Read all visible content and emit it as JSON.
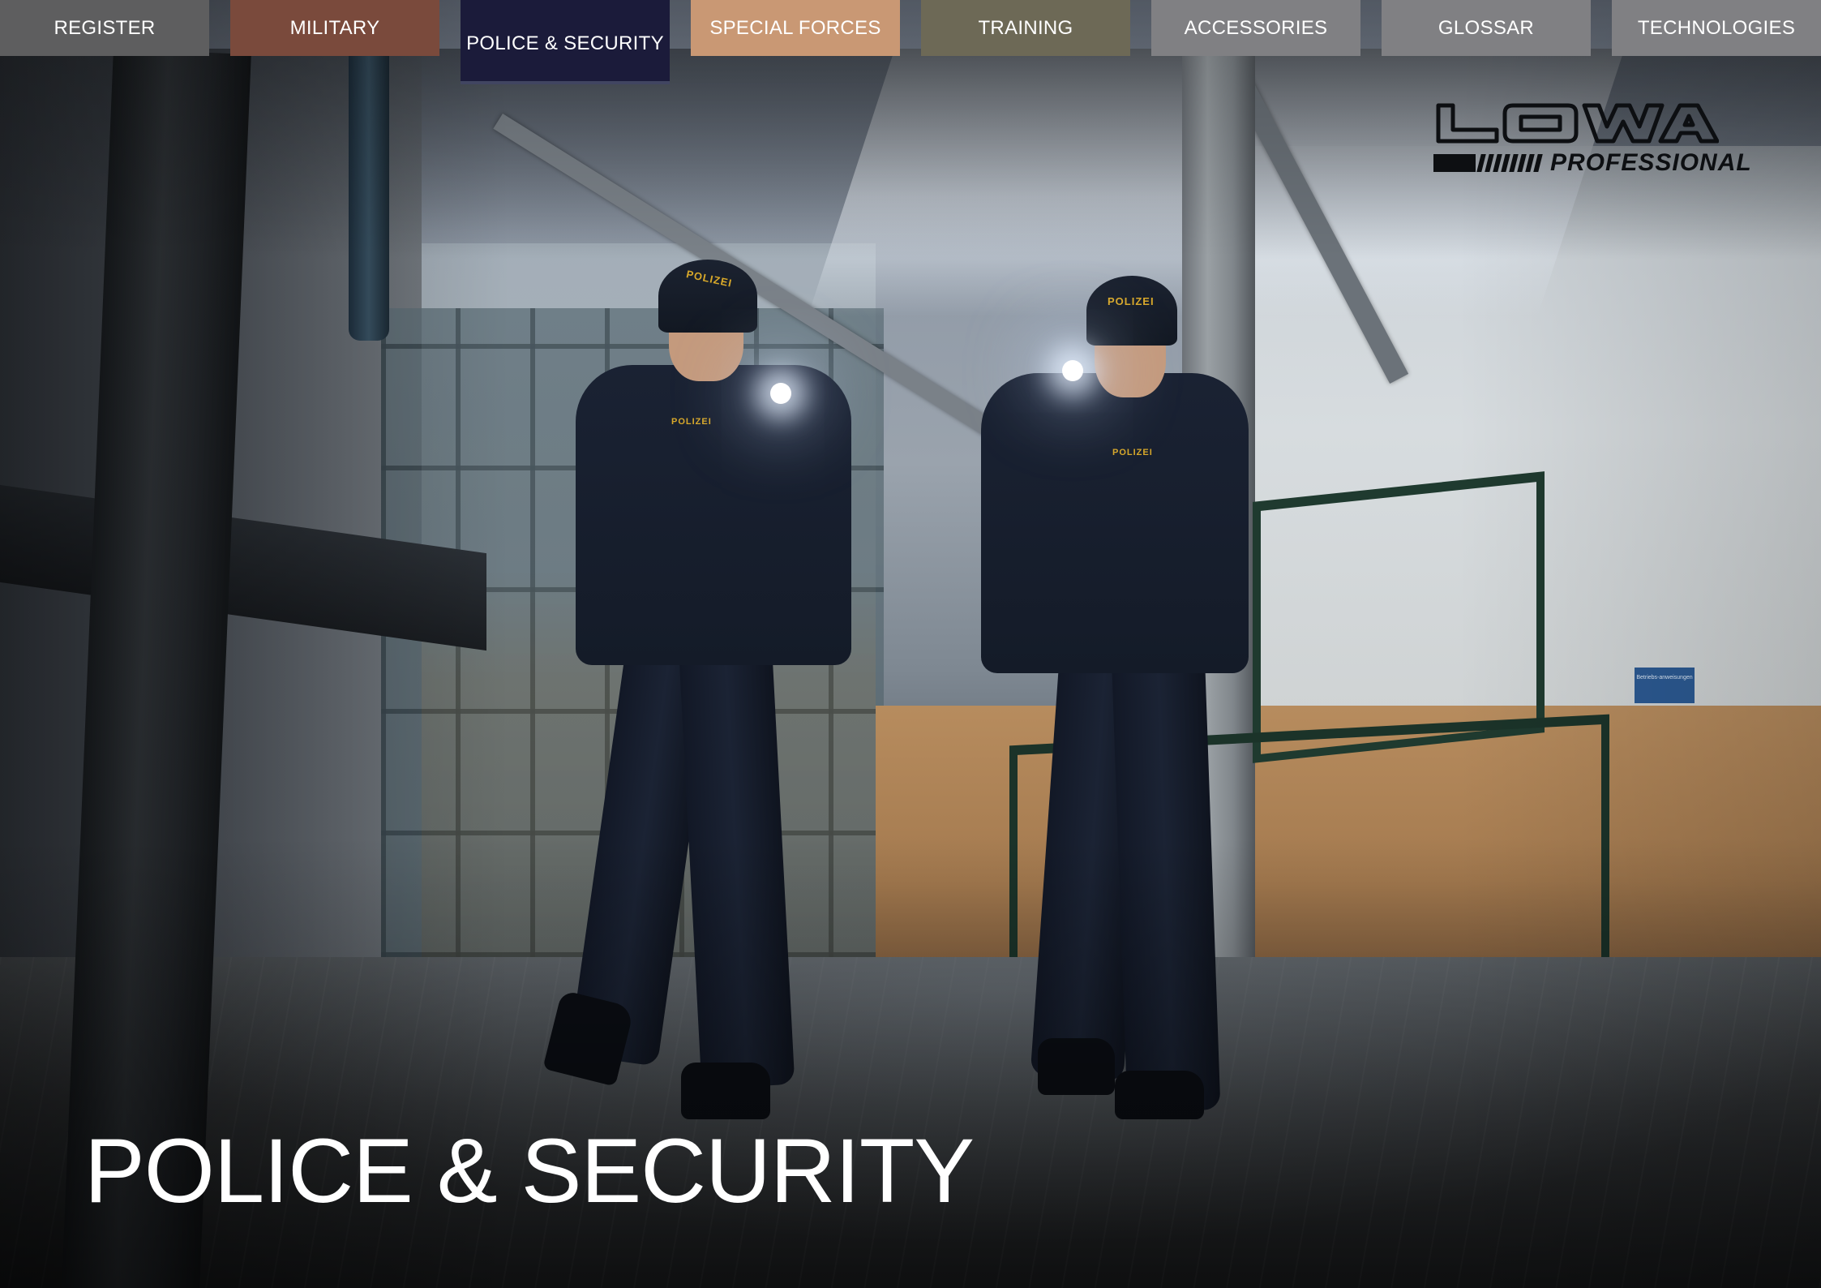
{
  "nav": {
    "tabs": [
      {
        "label": "REGISTER",
        "color": "#5e5e5f",
        "active": false
      },
      {
        "label": "MILITARY",
        "color": "#7a4a3c",
        "active": false
      },
      {
        "label": "POLICE & SECURITY",
        "color": "#1b1b3a",
        "active": true
      },
      {
        "label": "SPECIAL FORCES",
        "color": "#c99874",
        "active": false
      },
      {
        "label": "TRAINING",
        "color": "#6d6956",
        "active": false
      },
      {
        "label": "ACCESSORIES",
        "color": "#808083",
        "active": false
      },
      {
        "label": "GLOSSAR",
        "color": "#808083",
        "active": false
      },
      {
        "label": "TECHNOLOGIES",
        "color": "#808083",
        "active": false
      }
    ]
  },
  "logo": {
    "wordmark": "LOWA",
    "subline": "PROFESSIONAL"
  },
  "hero": {
    "title": "POLICE & SECURITY",
    "officer_label": "POLIZEI",
    "sign_text": "Betriebs-anweisungen"
  },
  "colors": {
    "title_text": "#ffffff",
    "logo_ink": "#0d0f12",
    "badge_gold": "#d8a82a"
  }
}
